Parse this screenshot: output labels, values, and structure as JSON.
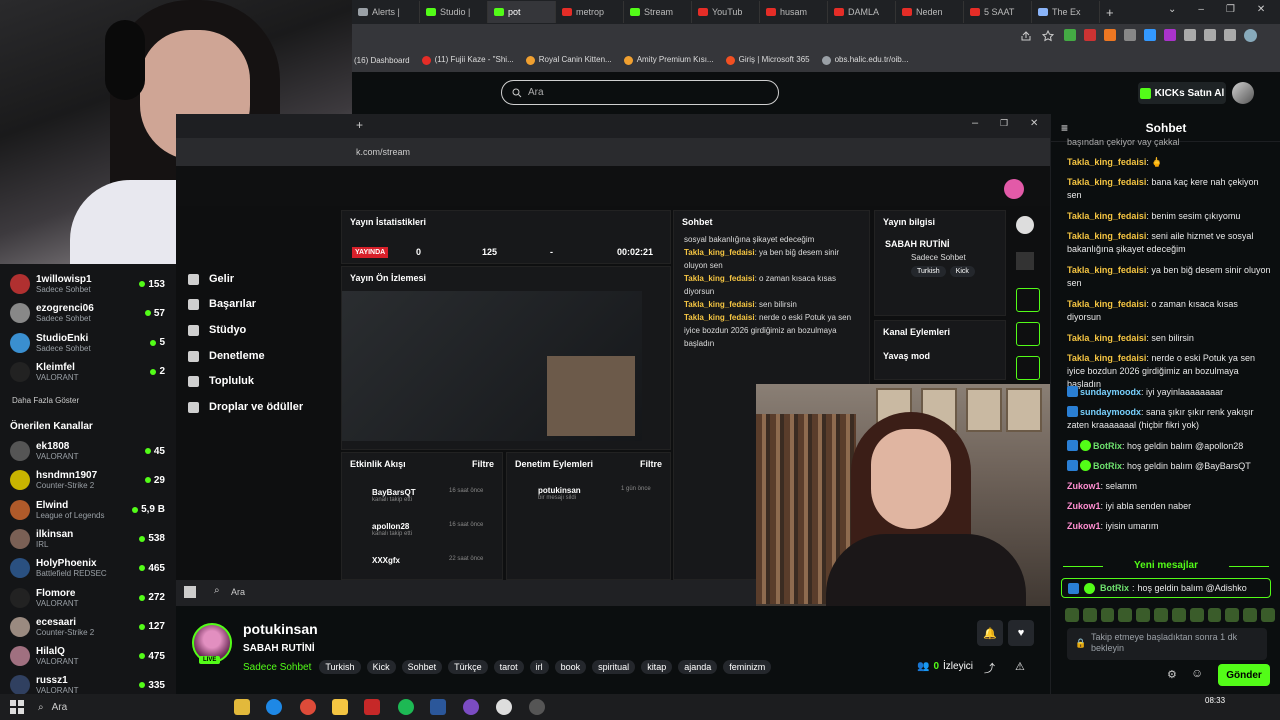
{
  "browser": {
    "tabs": [
      {
        "label": "Alerts |",
        "color": "#9aa0a6",
        "active": false
      },
      {
        "label": "Studio |",
        "color": "#53fc18",
        "active": false
      },
      {
        "label": "pot",
        "color": "#53fc18",
        "active": true
      },
      {
        "label": "metrop",
        "color": "#e52d27",
        "active": false
      },
      {
        "label": "Stream",
        "color": "#53fc18",
        "active": false
      },
      {
        "label": "YouTub",
        "color": "#e52d27",
        "active": false
      },
      {
        "label": "husam",
        "color": "#e52d27",
        "active": false
      },
      {
        "label": "DAMLA",
        "color": "#e52d27",
        "active": false
      },
      {
        "label": "Neden",
        "color": "#e52d27",
        "active": false
      },
      {
        "label": "5 SAAT",
        "color": "#e52d27",
        "active": false
      },
      {
        "label": "The Ex",
        "color": "#8ab4f8",
        "active": false
      }
    ],
    "bookmarks": [
      {
        "label": "(16) Dashboard",
        "color": ""
      },
      {
        "label": "(11) Fujii Kaze - \"Shi...",
        "color": "#e52d27"
      },
      {
        "label": "Royal Canin Kitten...",
        "color": "#f0a030"
      },
      {
        "label": "Amity Premium Kısı...",
        "color": "#f0a030"
      },
      {
        "label": "Giriş | Microsoft 365",
        "color": "#f25022"
      },
      {
        "label": "obs.halic.edu.tr/oib...",
        "color": "#9aa0a6"
      }
    ]
  },
  "header": {
    "search_placeholder": "Ara",
    "kicks_button": "KICKs Satın Al"
  },
  "sidebar": {
    "channels": [
      {
        "name": "1willowisp1",
        "sub": "Sadece Sohbet",
        "viewers": "153",
        "color": "#b03030"
      },
      {
        "name": "ezogrenci06",
        "sub": "Sadece Sohbet",
        "viewers": "57",
        "color": "#888"
      },
      {
        "name": "StudioEnki",
        "sub": "Sadece Sohbet",
        "viewers": "5",
        "color": "#3a8fd0"
      },
      {
        "name": "Kleimfel",
        "sub": "VALORANT",
        "viewers": "2",
        "color": "#222"
      }
    ],
    "show_more": "Daha Fazla Göster",
    "recommended_heading": "Önerilen Kanallar",
    "recommended": [
      {
        "name": "ek1808",
        "sub": "VALORANT",
        "viewers": "45",
        "color": "#555"
      },
      {
        "name": "hsndmn1907",
        "sub": "Counter-Strike 2",
        "viewers": "29",
        "color": "#c8b400"
      },
      {
        "name": "Elwind",
        "sub": "League of Legends",
        "viewers": "5,9 B",
        "color": "#b05a2a"
      },
      {
        "name": "ilkinsan",
        "sub": "IRL",
        "viewers": "538",
        "color": "#7a6055"
      },
      {
        "name": "HolyPhoenix",
        "sub": "Battlefield REDSEC",
        "viewers": "465",
        "color": "#2a5080"
      },
      {
        "name": "Flomore",
        "sub": "VALORANT",
        "viewers": "272",
        "color": "#222"
      },
      {
        "name": "ecesaari",
        "sub": "Counter-Strike 2",
        "viewers": "127",
        "color": "#9a8a80"
      },
      {
        "name": "HilalQ",
        "sub": "VALORANT",
        "viewers": "475",
        "color": "#a07080"
      },
      {
        "name": "russz1",
        "sub": "VALORANT",
        "viewers": "335",
        "color": "#304060"
      }
    ]
  },
  "capture": {
    "address": "k.com/stream",
    "menu": [
      "Gelir",
      "Başarılar",
      "Stüdyo",
      "Denetleme",
      "Topluluk",
      "Droplar ve ödüller"
    ],
    "stats_title": "Yayın İstatistikleri",
    "live_tag": "YAYINDA",
    "stats": [
      "0",
      "125",
      "-",
      "00:02:21"
    ],
    "preview_title": "Yayın Ön İzlemesi",
    "chat_title": "Sohbet",
    "info_title": "Yayın bilgisi",
    "info_stream_title": "SABAH RUTİNİ",
    "info_category": "Sadece Sohbet",
    "info_tags": [
      "Turkish",
      "Kick"
    ],
    "actions_title": "Kanal Eylemleri",
    "slow_mode": "Yavaş mod",
    "activity_title": "Etkinlik Akışı",
    "filter_label": "Filtre",
    "mod_title": "Denetim Eylemleri",
    "activity": [
      {
        "name": "BayBarsQT",
        "action": "kanalı takip etti",
        "time": "16 saat önce"
      },
      {
        "name": "apollon28",
        "action": "kanalı takip etti",
        "time": "16 saat önce"
      },
      {
        "name": "XXXgfx",
        "action": "kanalı takip etti",
        "time": "22 saat önce"
      }
    ],
    "mod_action": {
      "name": "potukinsan",
      "action": "bir mesajı sildi",
      "time": "1 gün önce"
    },
    "mini_chat": [
      {
        "user": "",
        "text": "sosyal bakanlığına şikayet edeceğim"
      },
      {
        "user": "Takla_king_fedaisi",
        "text": "ya ben biğ desem sinir oluyon sen"
      },
      {
        "user": "Takla_king_fedaisi",
        "text": "o zaman kısaca kısas diyorsun"
      },
      {
        "user": "Takla_king_fedaisi",
        "text": "sen bilirsin"
      },
      {
        "user": "Takla_king_fedaisi",
        "text": "nerde o eski Potuk ya sen iyice bozdun 2026 girdiğimiz an bozulmaya başladın"
      }
    ],
    "taskbar_search": "Ara"
  },
  "stream": {
    "streamer": "potukinsan",
    "live": "LIVE",
    "title": "SABAH RUTİNİ",
    "category": "Sadece Sohbet",
    "tags": [
      "Turkish",
      "Kick",
      "Sohbet",
      "Türkçe",
      "tarot",
      "irl",
      "book",
      "spiritual",
      "kitap",
      "ajanda",
      "feminizm"
    ],
    "viewer_count": "0",
    "viewer_label": "İzleyici"
  },
  "chat": {
    "title": "Sohbet",
    "partial_top": "başından çekiyor vay çakkal",
    "messages": [
      {
        "user": "Takla_king_fedaisi",
        "text": "🖕",
        "color": "orange",
        "badge": ""
      },
      {
        "user": "Takla_king_fedaisi",
        "text": "bana kaç kere nah çekiyon sen",
        "color": "orange",
        "badge": ""
      },
      {
        "user": "Takla_king_fedaisi",
        "text": "benim sesim çıkıyomu",
        "color": "orange",
        "badge": ""
      },
      {
        "user": "Takla_king_fedaisi",
        "text": "seni aile hizmet ve sosyal bakanlığına şikayet edeceğim",
        "color": "orange",
        "badge": ""
      },
      {
        "user": "Takla_king_fedaisi",
        "text": "ya ben biğ desem sinir oluyon sen",
        "color": "orange",
        "badge": ""
      },
      {
        "user": "Takla_king_fedaisi",
        "text": "o zaman kısaca kısas diyorsun",
        "color": "orange",
        "badge": ""
      },
      {
        "user": "Takla_king_fedaisi",
        "text": "sen bilirsin",
        "color": "orange",
        "badge": ""
      },
      {
        "user": "Takla_king_fedaisi",
        "text": "nerde o eski Potuk ya sen iyice bozdun 2026 girdiğimiz an bozulmaya başladın",
        "color": "orange",
        "badge": ""
      },
      {
        "user": "sundaymoodx",
        "text": "iyi yayinlaaaaaaaar",
        "color": "blue",
        "badge": "sub"
      },
      {
        "user": "sundaymoodx",
        "text": "sana şıkır şıkır renk yakışır zaten kraaaaaaal (hiçbir fikri yok)",
        "color": "blue",
        "badge": "sub"
      },
      {
        "user": "BotRix",
        "text": "hoş geldin balım @apollon28",
        "color": "green",
        "badge": "bot"
      },
      {
        "user": "BotRix",
        "text": "hoş geldin balım @BayBarsQT",
        "color": "green",
        "badge": "bot"
      },
      {
        "user": "Zukow1",
        "text": "selamm",
        "color": "pink",
        "badge": ""
      },
      {
        "user": "Zukow1",
        "text": "iyi abla senden naber",
        "color": "pink",
        "badge": ""
      },
      {
        "user": "Zukow1",
        "text": "iyisin umarım",
        "color": "pink",
        "badge": ""
      }
    ],
    "new_messages_label": "Yeni mesajlar",
    "highlight": {
      "user": "BotRix",
      "text": "hoş geldin balım @Adishko"
    },
    "input_placeholder": "Takip etmeye başladıktan sonra 1 dk bekleyin",
    "send_label": "Gönder"
  },
  "os_taskbar": {
    "search_placeholder": "Ara",
    "clock": "08:33"
  }
}
